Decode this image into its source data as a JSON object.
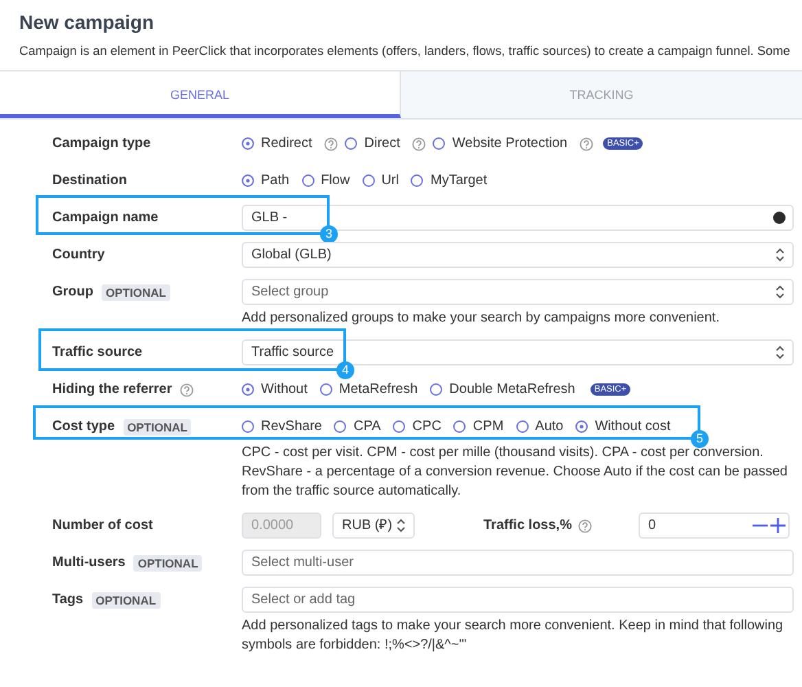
{
  "title": "New campaign",
  "description": "Campaign is an element in PeerClick that incorporates elements (offers, landers, flows, traffic sources) to create a campaign funnel. Some",
  "tabs": [
    {
      "label": "GENERAL",
      "selected": true
    },
    {
      "label": "TRACKING",
      "selected": false
    }
  ],
  "fields": [
    {
      "kind": "radio",
      "label": "Campaign type",
      "options": [
        {
          "label": "Redirect",
          "selected": true,
          "help": true
        },
        {
          "label": "Direct",
          "selected": false,
          "help": true
        },
        {
          "label": "Website Protection",
          "selected": false,
          "help": true,
          "badge": "BASIC+"
        }
      ]
    },
    {
      "kind": "radio",
      "label": "Destination",
      "options": [
        {
          "label": "Path",
          "selected": true
        },
        {
          "label": "Flow",
          "selected": false
        },
        {
          "label": "Url",
          "selected": false
        },
        {
          "label": "MyTarget",
          "selected": false
        }
      ]
    },
    {
      "kind": "text",
      "label": "Campaign name",
      "value": "GLB -",
      "color_dot": true,
      "callout": "3"
    },
    {
      "kind": "select",
      "label": "Country",
      "value": "Global (GLB)"
    },
    {
      "kind": "select",
      "label": "Group",
      "tag": "OPTIONAL",
      "placeholder": "Select group",
      "hint": "Add personalized groups to make your search by campaigns more convenient."
    },
    {
      "kind": "select",
      "label": "Traffic source",
      "value": "Traffic source",
      "callout": "4"
    },
    {
      "kind": "radio",
      "label": "Hiding the referrer",
      "help": true,
      "options": [
        {
          "label": "Without",
          "selected": true
        },
        {
          "label": "MetaRefresh",
          "selected": false
        },
        {
          "label": "Double MetaRefresh",
          "selected": false,
          "badge": "BASIC+"
        }
      ]
    },
    {
      "kind": "radio",
      "label": "Cost type",
      "tag": "OPTIONAL",
      "callout": "5",
      "options": [
        {
          "label": "RevShare",
          "selected": false
        },
        {
          "label": "CPA",
          "selected": false
        },
        {
          "label": "CPC",
          "selected": false
        },
        {
          "label": "CPM",
          "selected": false
        },
        {
          "label": "Auto",
          "selected": false
        },
        {
          "label": "Without cost",
          "selected": true
        }
      ],
      "hint": "CPC - cost per visit. CPM - cost per mille (thousand visits). CPA - cost per conversion. RevShare - a percentage of a conversion revenue. Choose Auto if the cost can be passed from the traffic source automatically."
    },
    {
      "kind": "cost",
      "label": "Number of cost",
      "amount": {
        "placeholder": "0.0000",
        "disabled": true
      },
      "currency": "RUB (₽)",
      "loss_label": "Traffic loss,%",
      "loss_help": true,
      "loss_value": "0"
    },
    {
      "kind": "text",
      "label": "Multi-users",
      "tag": "OPTIONAL",
      "placeholder": "Select multi-user"
    },
    {
      "kind": "text",
      "label": "Tags",
      "tag": "OPTIONAL",
      "placeholder": "Select or add tag",
      "hint": "Add personalized tags to make your search more convenient. Keep in mind that following symbols are forbidden: !;%<>?/|&^~'\""
    }
  ]
}
